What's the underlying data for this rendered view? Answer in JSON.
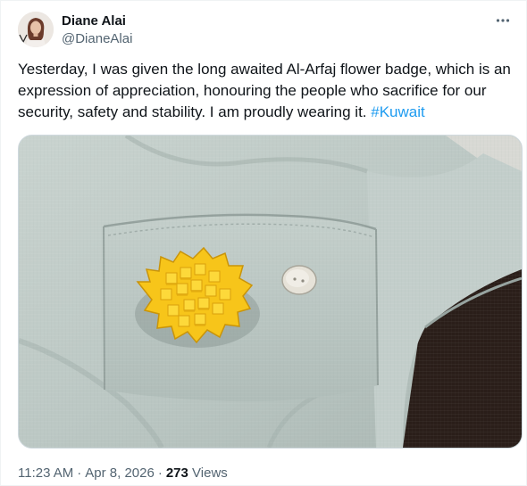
{
  "author": {
    "display_name": "Diane Alai",
    "handle": "@DianeAlai"
  },
  "more_icon": "more-horizontal-icon",
  "tweet": {
    "text": "Yesterday, I was given the long awaited Al-Arfaj flower badge, which is an expression of appreciation, honouring the people who sacrifice for our security, safety and stability. I am proudly wearing it. ",
    "hashtag": "#Kuwait"
  },
  "media": {
    "subject": "yellow flower badge pinned on light blue linen shirt pocket"
  },
  "meta": {
    "time": "11:23 AM",
    "separator": "·",
    "date": "Apr 8, 2026",
    "views_count": "273",
    "views_label": "Views"
  },
  "colors": {
    "text": "#0f1419",
    "secondary": "#536471",
    "link": "#1d9bf0",
    "badge": "#f7c51a",
    "shirt": "#c4cfcb"
  }
}
